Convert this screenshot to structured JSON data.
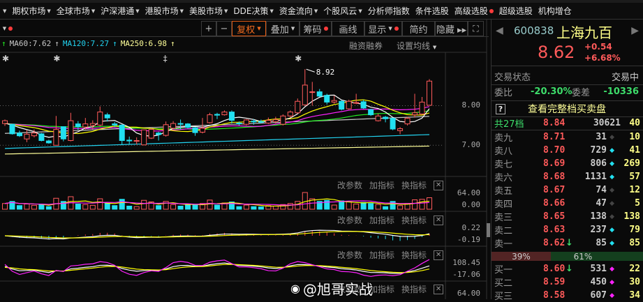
{
  "menu": [
    {
      "label": "期权市场",
      "caret": true
    },
    {
      "label": "全球市场",
      "caret": true
    },
    {
      "label": "沪深港通",
      "caret": true
    },
    {
      "label": "港股市场",
      "caret": true
    },
    {
      "label": "美股市场",
      "caret": true
    },
    {
      "label": "DDE决策",
      "caret": true
    },
    {
      "label": "资金流向",
      "caret": true
    },
    {
      "label": "个股风云",
      "caret": true
    },
    {
      "label": "分析师指数"
    },
    {
      "label": "条件选股"
    },
    {
      "label": "高级选股",
      "dot": true
    },
    {
      "label": "超级选股"
    },
    {
      "label": "机构增仓"
    }
  ],
  "toolbar": {
    "plus": "+",
    "minus": "−",
    "fuquan": "复权",
    "diejia": "叠加",
    "chouma": "筹码",
    "huaxian": "画线",
    "xianshi": "显示",
    "jianyue": "简约",
    "yincang": "隐藏 ▸▸"
  },
  "ma_labels": [
    {
      "text": "MA60:7.62",
      "color": "#c8c8c8"
    },
    {
      "text": "MA120:7.27",
      "color": "#22d3f0"
    },
    {
      "text": "MA250:6.98",
      "color": "#ffff99"
    }
  ],
  "links": {
    "rzrq": "融资融券",
    "setma": "设置均线"
  },
  "axis": {
    "main": [
      "8.00",
      "7.00"
    ],
    "vol": [
      "64.00",
      "0.00"
    ],
    "macd": [
      "0.22",
      "-0.19"
    ],
    "kdj": [
      "108.45",
      "-17.06"
    ],
    "p4": [
      "64.00"
    ]
  },
  "panel_actions": {
    "edit": "改参数",
    "add": "加指标",
    "swap": "换指标"
  },
  "high_label": "8.92",
  "watermark": "@旭哥实战",
  "stock": {
    "code": "600838",
    "name": "上海九百",
    "price": "8.62",
    "change": "+0.54",
    "pct": "+6.68%"
  },
  "status": {
    "label": "交易状态",
    "value": "交易中"
  },
  "weibi": {
    "label": "委比",
    "value": "-20.30%",
    "diff_label": "委差",
    "diff_value": "-10336"
  },
  "full_book": "查看完整档买卖盘",
  "help": "?",
  "total": {
    "label": "共27档",
    "price": "8.84",
    "vol": "30621",
    "count": "40"
  },
  "asks": [
    {
      "label": "卖九",
      "price": "8.71",
      "vol": "31",
      "dot": "#444",
      "count": "10"
    },
    {
      "label": "卖八",
      "price": "8.70",
      "vol": "729",
      "dot": "#22e0f0",
      "count": "41"
    },
    {
      "label": "卖七",
      "price": "8.69",
      "vol": "806",
      "dot": "#22e0f0",
      "count": "269"
    },
    {
      "label": "卖六",
      "price": "8.68",
      "vol": "1131",
      "dot": "#22e0f0",
      "count": "57"
    },
    {
      "label": "卖五",
      "price": "8.67",
      "vol": "74",
      "dot": "#444",
      "count": "12"
    },
    {
      "label": "卖四",
      "price": "8.66",
      "vol": "47",
      "dot": "#444",
      "count": "5"
    },
    {
      "label": "卖三",
      "price": "8.65",
      "vol": "138",
      "dot": "#444",
      "count": "138"
    },
    {
      "label": "卖二",
      "price": "8.63",
      "vol": "237",
      "dot": "#22e0f0",
      "count": "79"
    },
    {
      "label": "卖一",
      "price": "8.62",
      "arrow": "↓",
      "vol": "85",
      "dot": "#22e0f0",
      "count": "85"
    }
  ],
  "ratio": {
    "sell": "39%",
    "buy": "61%",
    "sell_frac": 0.39
  },
  "bids": [
    {
      "label": "买一",
      "price": "8.60",
      "arrow": "↓",
      "vol": "531",
      "dot": "#ff22ff",
      "count": "22"
    },
    {
      "label": "买二",
      "price": "8.59",
      "vol": "450",
      "dot": "#ff22ff",
      "count": "30"
    },
    {
      "label": "买三",
      "price": "8.58",
      "vol": "607",
      "dot": "#ff22ff",
      "count": "34"
    }
  ],
  "chart_data": {
    "type": "candlestick",
    "ylim": [
      6.5,
      9.2
    ],
    "ohlc": [
      [
        7.55,
        7.65,
        7.49,
        7.62
      ],
      [
        7.53,
        7.53,
        7.27,
        7.29
      ],
      [
        7.31,
        7.37,
        7.21,
        7.24
      ],
      [
        7.16,
        7.38,
        7.08,
        7.28
      ],
      [
        7.24,
        7.4,
        7.2,
        7.31
      ],
      [
        7.29,
        7.31,
        7.1,
        7.12
      ],
      [
        7.11,
        7.14,
        7.04,
        7.06
      ],
      [
        7.0,
        7.74,
        7.0,
        7.4
      ],
      [
        7.47,
        7.47,
        7.1,
        7.16
      ],
      [
        7.12,
        7.82,
        7.1,
        7.62
      ],
      [
        7.54,
        7.61,
        7.39,
        7.47
      ],
      [
        7.46,
        7.69,
        7.4,
        7.54
      ],
      [
        7.5,
        7.63,
        7.4,
        7.55
      ],
      [
        7.51,
        7.98,
        7.48,
        7.84
      ],
      [
        7.77,
        7.82,
        7.6,
        7.69
      ],
      [
        7.54,
        7.59,
        7.46,
        7.51
      ],
      [
        7.51,
        7.53,
        7.0,
        7.12
      ],
      [
        7.13,
        7.22,
        7.02,
        7.11
      ],
      [
        7.1,
        7.2,
        7.02,
        7.12
      ],
      [
        7.01,
        7.39,
        7.0,
        7.39
      ],
      [
        7.18,
        7.44,
        7.16,
        7.4
      ],
      [
        7.31,
        7.34,
        7.12,
        7.27
      ],
      [
        7.25,
        7.6,
        7.22,
        7.52
      ],
      [
        7.43,
        7.61,
        7.4,
        7.55
      ],
      [
        7.55,
        7.65,
        7.4,
        7.53
      ],
      [
        7.54,
        7.56,
        7.42,
        7.45
      ],
      [
        7.44,
        7.46,
        7.24,
        7.32
      ],
      [
        7.33,
        7.69,
        7.3,
        7.43
      ],
      [
        7.57,
        7.82,
        7.55,
        7.77
      ],
      [
        7.78,
        7.82,
        7.66,
        7.76
      ],
      [
        7.77,
        7.88,
        7.75,
        7.84
      ],
      [
        7.84,
        7.88,
        7.55,
        7.63
      ],
      [
        7.56,
        7.6,
        7.5,
        7.55
      ],
      [
        7.53,
        7.66,
        7.5,
        7.64
      ],
      [
        7.61,
        7.66,
        7.52,
        7.59
      ],
      [
        7.6,
        7.65,
        7.55,
        7.58
      ],
      [
        7.56,
        7.7,
        7.54,
        7.63
      ],
      [
        7.6,
        7.72,
        7.55,
        7.65
      ],
      [
        7.53,
        7.78,
        7.5,
        7.74
      ],
      [
        7.74,
        7.88,
        7.7,
        7.84
      ],
      [
        7.82,
        8.18,
        7.8,
        8.11
      ],
      [
        8.02,
        8.92,
        8.0,
        8.52
      ],
      [
        8.34,
        8.6,
        8.0,
        8.35
      ],
      [
        8.35,
        8.42,
        8.22,
        8.24
      ],
      [
        8.26,
        8.3,
        8.03,
        8.09
      ],
      [
        8.09,
        8.25,
        8.05,
        8.13
      ],
      [
        8.11,
        8.14,
        7.88,
        7.91
      ],
      [
        7.92,
        8.15,
        7.9,
        8.11
      ],
      [
        8.06,
        8.3,
        8.04,
        8.08
      ],
      [
        8.1,
        8.15,
        7.92,
        7.94
      ],
      [
        7.9,
        7.92,
        7.74,
        7.77
      ],
      [
        7.62,
        7.8,
        7.6,
        7.74
      ],
      [
        7.71,
        7.74,
        7.58,
        7.67
      ],
      [
        7.68,
        7.7,
        7.38,
        7.41
      ],
      [
        7.37,
        7.46,
        7.28,
        7.42
      ],
      [
        7.54,
        7.72,
        7.5,
        7.68
      ],
      [
        7.77,
        8.3,
        7.7,
        7.82
      ],
      [
        7.79,
        8.22,
        7.77,
        8.09
      ],
      [
        8.01,
        8.67,
        8.0,
        8.62
      ]
    ],
    "volume": [
      22,
      30,
      14,
      20,
      15,
      18,
      10,
      42,
      30,
      48,
      20,
      18,
      15,
      40,
      22,
      14,
      38,
      12,
      10,
      34,
      28,
      14,
      30,
      18,
      12,
      16,
      18,
      22,
      35,
      16,
      24,
      28,
      10,
      16,
      10,
      9,
      14,
      12,
      18,
      22,
      30,
      64,
      40,
      30,
      34,
      16,
      32,
      28,
      20,
      26,
      22,
      18,
      10,
      30,
      14,
      22,
      36,
      38,
      44
    ],
    "long_ma": {
      "MA60": [
        7.3,
        7.73
      ],
      "MA120": [
        6.92,
        7.27
      ],
      "MA250": [
        6.78,
        6.98
      ]
    },
    "markers": [
      {
        "index": 0,
        "symbol": "✱"
      },
      {
        "index": 7,
        "symbol": "✱"
      },
      {
        "index": 22,
        "symbol": "‡"
      },
      {
        "index": 40,
        "symbol": "✱"
      }
    ]
  }
}
